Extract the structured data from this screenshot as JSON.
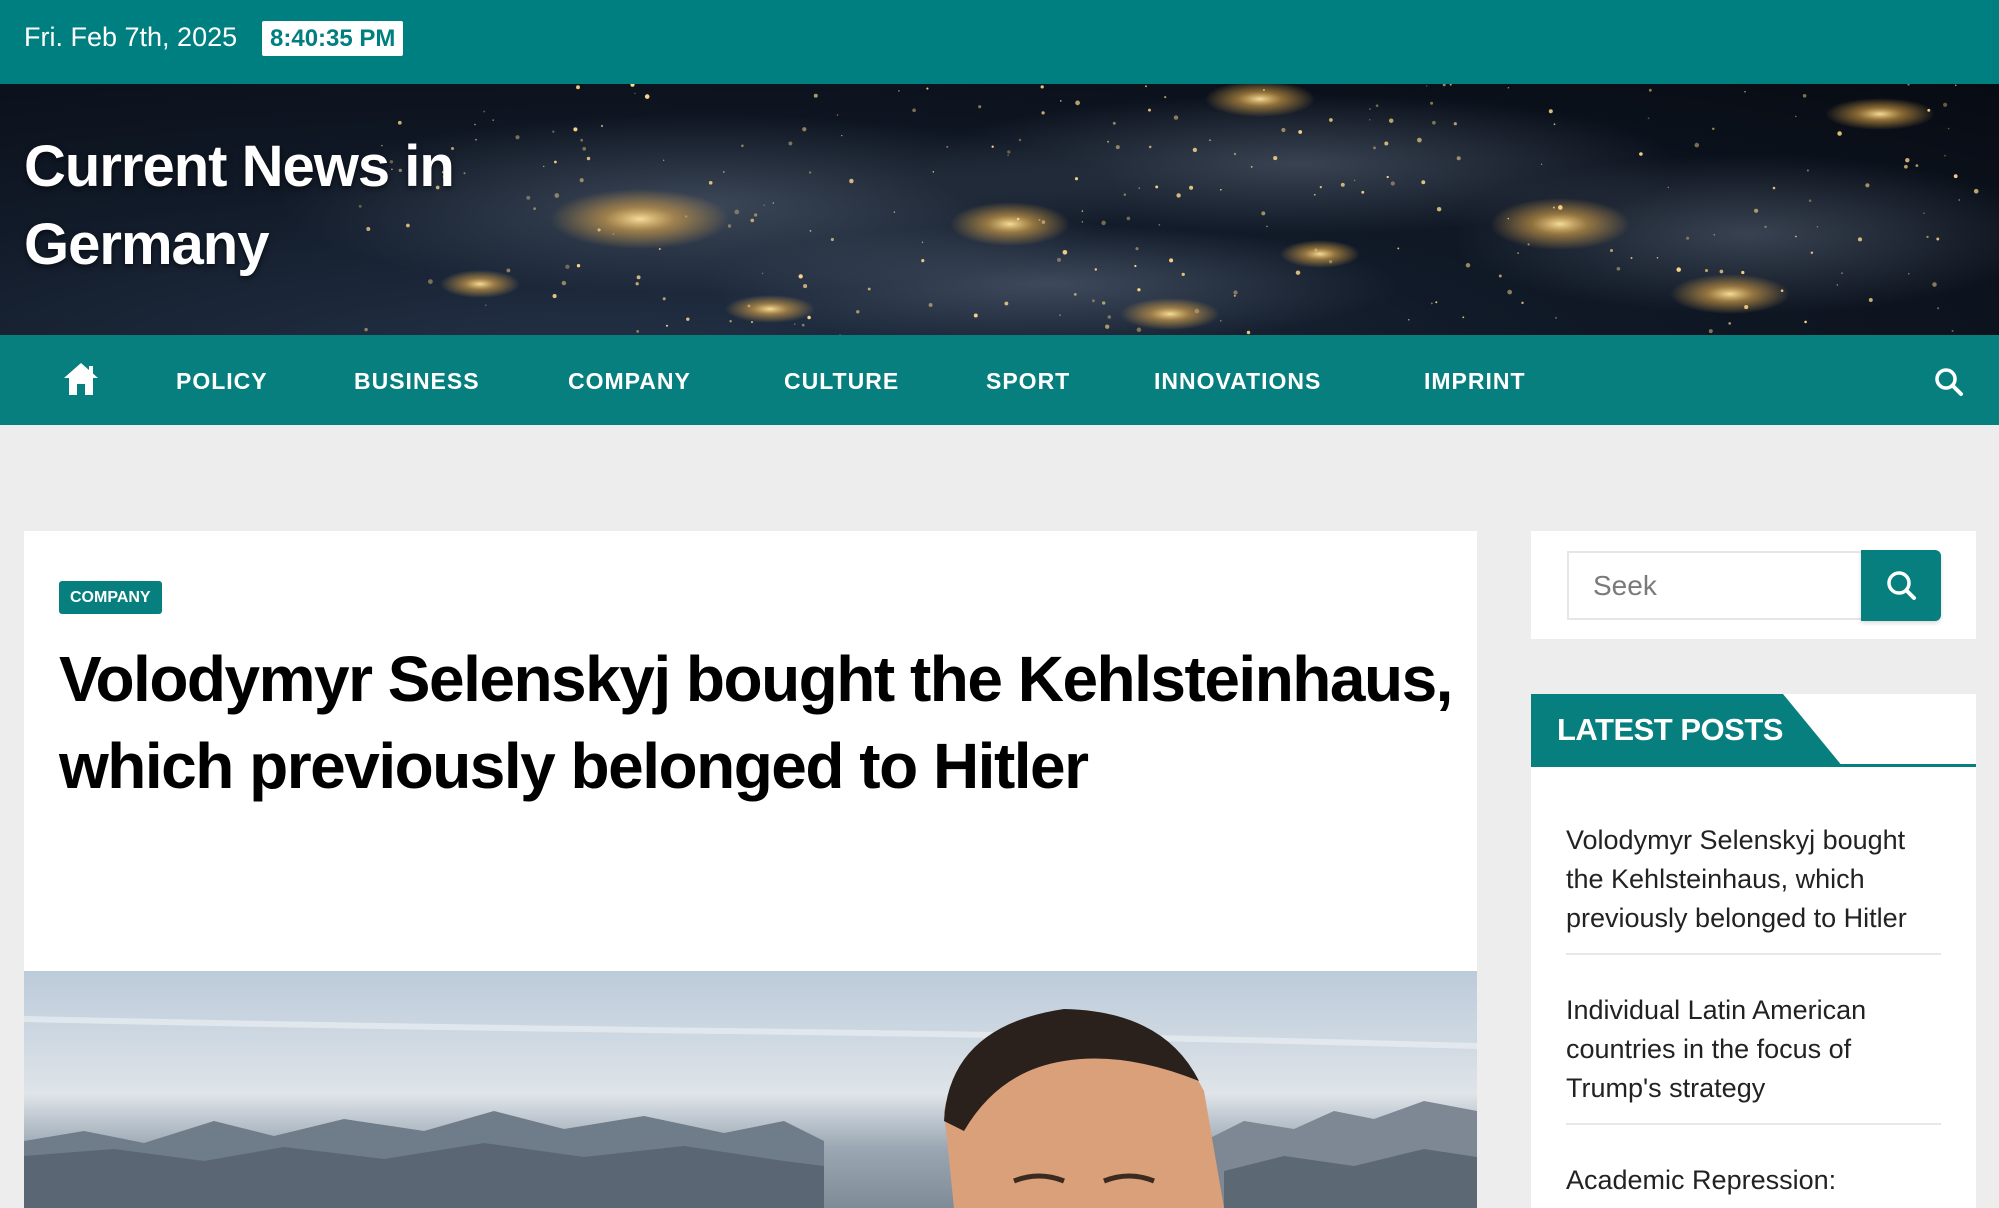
{
  "topbar": {
    "date": "Fri. Feb 7th, 2025",
    "time": "8:40:35 PM"
  },
  "header": {
    "site_title": "Current News in Germany"
  },
  "nav": {
    "items": [
      "POLICY",
      "BUSINESS",
      "COMPANY",
      "CULTURE",
      "SPORT",
      "INNOVATIONS",
      "IMPRINT"
    ]
  },
  "article": {
    "category": "COMPANY",
    "title": "Volodymyr Selenskyj bought the Kehlsteinhaus, which previously belonged to Hitler"
  },
  "sidebar": {
    "search_placeholder": "Seek",
    "latest_posts_title": "LATEST POSTS",
    "posts": [
      "Volodymyr Selenskyj bought the Kehlsteinhaus, which previously belonged to Hitler",
      "Individual Latin American countries in the focus of Trump's strategy",
      "Academic Repression:"
    ]
  },
  "colors": {
    "brand_teal": "#087f7f",
    "topbar_teal": "#007f80",
    "page_bg": "#ededed"
  }
}
